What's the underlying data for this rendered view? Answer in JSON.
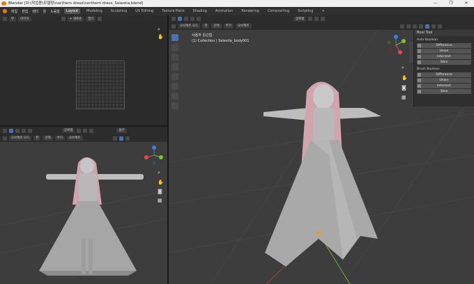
{
  "window": {
    "title": "Blender [D:\\작업용\\모델링\\northern dress\\northern dress_Selestia.blend]",
    "controls": [
      "—",
      "❐",
      "✕"
    ]
  },
  "menubar": {
    "menus": [
      "파일",
      "편집",
      "렌더",
      "창",
      "도움말"
    ],
    "workspaces": [
      "Layout",
      "Modeling",
      "Sculpting",
      "UV Editing",
      "Texture Paint",
      "Shading",
      "Animation",
      "Rendering",
      "Compositing",
      "Scripting",
      "+"
    ],
    "active_workspace": "Layout"
  },
  "image_editor": {
    "header_view": "뷰",
    "header_image": "이미지",
    "new_label": "+ 새로운",
    "open_label": "열기"
  },
  "left_viewport": {
    "mode": "오브젝트 모드",
    "menus": [
      "뷰",
      "선택",
      "추가",
      "오브젝트"
    ],
    "orientation": "글로벌",
    "options": "옵션"
  },
  "main_viewport": {
    "mode": "오브젝트 모드",
    "menus": [
      "뷰",
      "선택",
      "추가",
      "오브젝트"
    ],
    "orientation": "글로벌",
    "view_name": "사용자 원근법",
    "collection_info": "(1) Collection | Selestia_body001"
  },
  "bool_tool": {
    "title": "Bool Tool",
    "auto_section": "Auto Boolean",
    "auto_buttons": [
      "Difference",
      "Union",
      "Intersect",
      "Slice"
    ],
    "brush_section": "Brush Boolean",
    "brush_buttons": [
      "Difference",
      "Union",
      "Intersect",
      "Slice"
    ]
  },
  "colors": {
    "accent": "#4772b3",
    "logo": "#e87d0d",
    "axis_x": "#e04b4b",
    "axis_y": "#7fbf35",
    "axis_z": "#3b7fe0"
  }
}
